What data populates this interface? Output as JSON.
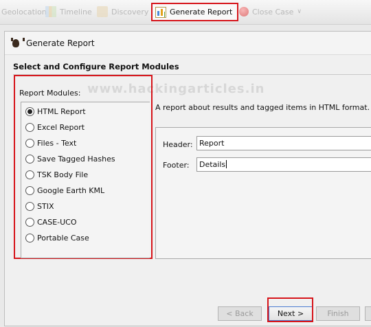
{
  "toolbar": {
    "items": [
      {
        "label": "Geolocation",
        "state": "disabled"
      },
      {
        "label": "Timeline",
        "state": "disabled"
      },
      {
        "label": "Discovery",
        "state": "disabled"
      },
      {
        "label": "Generate Report",
        "state": "active"
      },
      {
        "label": "Close Case",
        "state": "disabled"
      }
    ]
  },
  "dialog": {
    "title": "Generate Report",
    "step_header": "Select and Configure Report Modules",
    "watermark": "www.hackingarticles.in",
    "modules_label": "Report Modules:",
    "modules": [
      {
        "label": "HTML Report",
        "selected": true
      },
      {
        "label": "Excel Report",
        "selected": false
      },
      {
        "label": "Files - Text",
        "selected": false
      },
      {
        "label": "Save Tagged Hashes",
        "selected": false
      },
      {
        "label": "TSK Body File",
        "selected": false
      },
      {
        "label": "Google Earth KML",
        "selected": false
      },
      {
        "label": "STIX",
        "selected": false
      },
      {
        "label": "CASE-UCO",
        "selected": false
      },
      {
        "label": "Portable Case",
        "selected": false
      }
    ],
    "description": "A report about results and tagged items in HTML format.",
    "config": {
      "header_label": "Header:",
      "header_value": "Report",
      "footer_label": "Footer:",
      "footer_value": "Details"
    },
    "buttons": {
      "back": "< Back",
      "next": "Next >",
      "finish": "Finish"
    }
  },
  "colors": {
    "highlight": "#d6141a",
    "focus": "#4a7bd0"
  }
}
